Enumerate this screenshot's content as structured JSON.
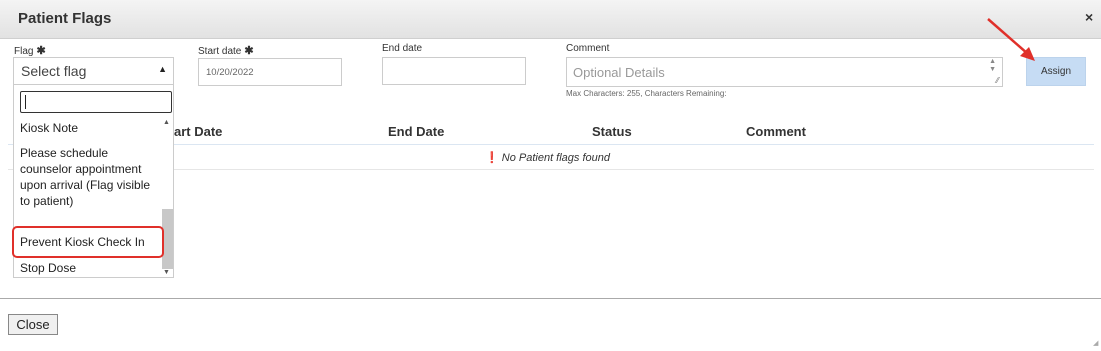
{
  "dialog": {
    "title": "Patient Flags",
    "close_symbol": "×"
  },
  "form": {
    "flag_label": "Flag",
    "start_date_label": "Start date",
    "end_date_label": "End date",
    "comment_label": "Comment",
    "required_marker": "✱",
    "flag_select_value": "Select flag",
    "start_date_value": "10/20/2022",
    "end_date_value": "",
    "comment_placeholder": "Optional Details",
    "max_chars_note": "Max Characters: 255, Characters Remaining:",
    "assign_label": "Assign"
  },
  "flag_options": [
    "Kiosk Note",
    "Please schedule counselor appointment upon arrival (Flag visible to patient)",
    "Prevent Kiosk Check In",
    "Stop Dose"
  ],
  "table": {
    "columns": [
      "Start Date",
      "End Date",
      "Status",
      "Comment"
    ],
    "visible_first_column": "art Date",
    "empty_message": "No Patient flags found"
  },
  "footer": {
    "close_label": "Close"
  },
  "colors": {
    "assign_bg": "#c6dcf4",
    "highlight": "#e0302a",
    "arrow": "#e0302a"
  },
  "icons": {
    "info": "info-circle-icon",
    "close": "close-icon"
  }
}
